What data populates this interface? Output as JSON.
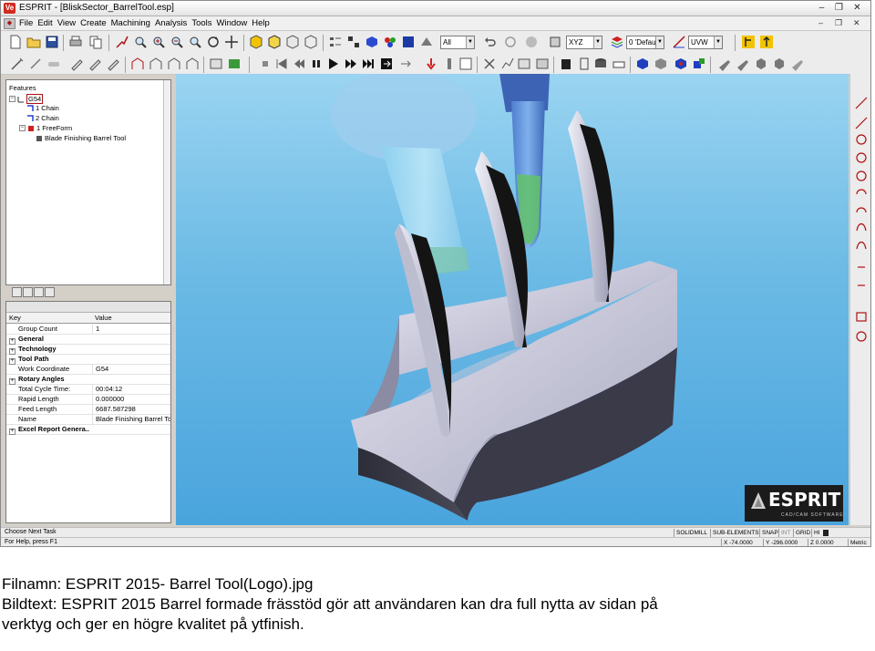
{
  "window": {
    "app_icon_text": "Ve",
    "title": "ESPRIT - [BliskSector_BarrelTool.esp]",
    "controls": [
      "‒",
      "❐",
      "✕"
    ]
  },
  "menu": {
    "items": [
      "File",
      "Edit",
      "View",
      "Create",
      "Machining",
      "Analysis",
      "Tools",
      "Window",
      "Help"
    ],
    "doc_controls": [
      "‒",
      "❐",
      "✕"
    ]
  },
  "toolbar": {
    "filter_combo": "All",
    "plane_combo": "XYZ",
    "layer_combo": "0 'Defau",
    "work_plane_combo": "UVW"
  },
  "tree": {
    "root": "Features",
    "items": [
      {
        "label": "G54",
        "level": 1
      },
      {
        "label": "1 Chain",
        "level": 2
      },
      {
        "label": "2 Chain",
        "level": 2
      },
      {
        "label": "1 FreeForm",
        "level": 2
      },
      {
        "label": "Blade Finishing Barrel Tool",
        "level": 3
      }
    ]
  },
  "properties": {
    "headers": [
      "Key",
      "Value"
    ],
    "rows": [
      {
        "key": "Group Count",
        "value": "1",
        "bold": false,
        "expander": false
      },
      {
        "key": "General",
        "value": "",
        "bold": true,
        "expander": true
      },
      {
        "key": "Technology",
        "value": "",
        "bold": true,
        "expander": true
      },
      {
        "key": "Tool Path",
        "value": "",
        "bold": true,
        "expander": true
      },
      {
        "key": "Work Coordinate",
        "value": "G54",
        "bold": false,
        "expander": false
      },
      {
        "key": "Rotary Angles",
        "value": "",
        "bold": true,
        "expander": true
      },
      {
        "key": "Total Cycle Time:",
        "value": "00:04:12",
        "bold": false,
        "expander": false
      },
      {
        "key": "Rapid Length",
        "value": "0.000000",
        "bold": false,
        "expander": false
      },
      {
        "key": "Feed Length",
        "value": "6687.587298",
        "bold": false,
        "expander": false
      },
      {
        "key": "Name",
        "value": "Blade Finishing Barrel To...",
        "bold": false,
        "expander": false
      },
      {
        "key": "Excel Report Genera...",
        "value": "",
        "bold": true,
        "expander": true
      }
    ]
  },
  "logo": {
    "word": "ESPRIT",
    "tagline": "CAD/CAM SOFTWARE"
  },
  "status": {
    "task_prompt": "Choose Next Task",
    "help_hint": "For Help, press F1",
    "modes": [
      "SOLIDMILL",
      "SUB-ELEMENTS",
      "SNAP",
      "INT",
      "GRID",
      "HI"
    ],
    "x": "X -74.0000",
    "y": "Y -296.0000",
    "z": "Z 0.0000",
    "units": "Metric"
  },
  "caption": {
    "line1": "Filnamn: ESPRIT 2015- Barrel Tool(Logo).jpg",
    "line2": "Bildtext: ESPRIT 2015 Barrel formade frässtöd gör att användaren kan dra full nytta av sidan på",
    "line3": "verktyg och ger en högre kvalitet på ytfinish."
  },
  "colors": {
    "viewport_top": "#9ad4f1",
    "viewport_bottom": "#4aa4dd",
    "part_top": "#c9c9dc",
    "part_side": "#3d3d4a",
    "blade_face": "#151515",
    "blade_edge": "#d8d8e4"
  }
}
